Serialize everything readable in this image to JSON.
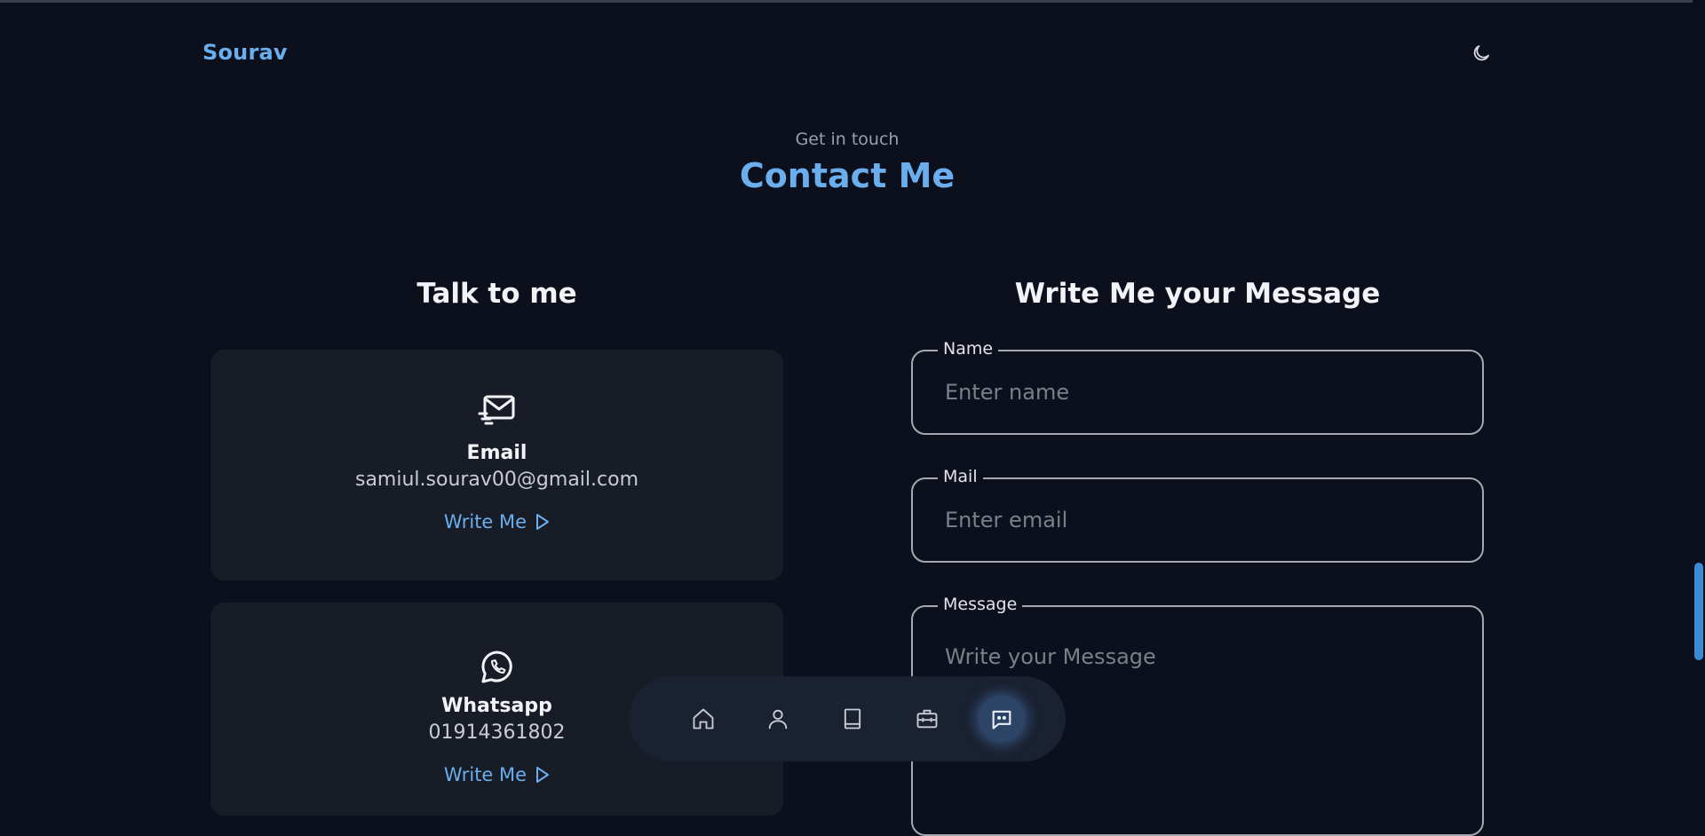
{
  "header": {
    "logo": "Sourav",
    "theme_toggle_icon": "moon-icon"
  },
  "section": {
    "subtitle": "Get in touch",
    "title": "Contact Me"
  },
  "talk": {
    "title": "Talk to me",
    "cards": [
      {
        "icon": "mail-send-icon",
        "label": "Email",
        "value": "samiul.sourav00@gmail.com",
        "link": "Write Me"
      },
      {
        "icon": "whatsapp-icon",
        "label": "Whatsapp",
        "value": "01914361802",
        "link": "Write Me"
      }
    ]
  },
  "form": {
    "title": "Write Me your Message",
    "fields": [
      {
        "label": "Name",
        "placeholder": "Enter name"
      },
      {
        "label": "Mail",
        "placeholder": "Enter email"
      },
      {
        "label": "Message",
        "placeholder": "Write your Message"
      }
    ]
  },
  "nav": {
    "items": [
      {
        "icon": "home-icon"
      },
      {
        "icon": "user-icon"
      },
      {
        "icon": "book-icon"
      },
      {
        "icon": "briefcase-icon"
      },
      {
        "icon": "chat-icon",
        "active": true
      }
    ]
  },
  "colors": {
    "background": "#0b101c",
    "accent": "#6aaeee",
    "card": "#171c27"
  }
}
